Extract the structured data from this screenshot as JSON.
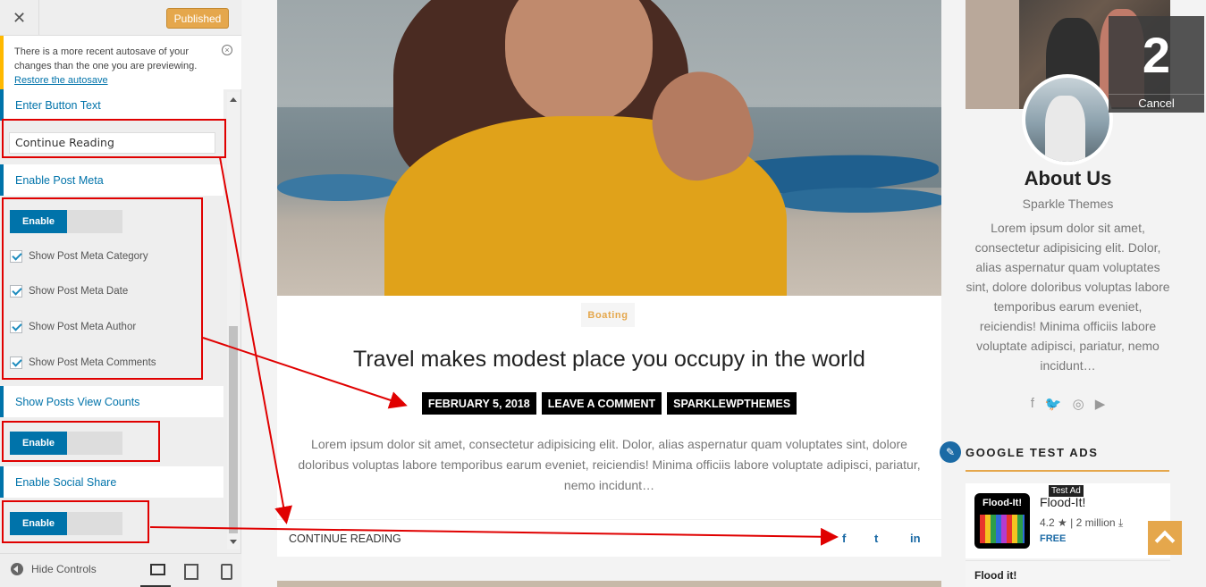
{
  "sidebar": {
    "published_label": "Published",
    "notice": {
      "text": "There is a more recent autosave of your changes than the one you are previewing.",
      "link": "Restore the autosave"
    },
    "sections": {
      "button_text": {
        "title": "Enter Button Text",
        "value": "Continue Reading"
      },
      "post_meta": {
        "title": "Enable Post Meta",
        "toggle_label": "Enable",
        "checkboxes": [
          "Show Post Meta Category",
          "Show Post Meta Date",
          "Show Post Meta Author",
          "Show Post Meta Comments"
        ]
      },
      "view_counts": {
        "title": "Show Posts View Counts",
        "toggle_label": "Enable"
      },
      "social_share": {
        "title": "Enable Social Share",
        "toggle_label": "Enable"
      }
    },
    "footer": {
      "hide_controls": "Hide Controls"
    }
  },
  "post": {
    "category": "Boating",
    "title": "Travel makes modest place you occupy in the world",
    "meta": [
      "FEBRUARY 5, 2018",
      "LEAVE A COMMENT",
      "SPARKLEWPTHEMES"
    ],
    "excerpt": "Lorem ipsum dolor sit amet, consectetur adipisicing elit. Dolor, alias aspernatur quam voluptates sint, dolore doloribus voluptas labore temporibus earum eveniet, reiciendis! Minima officiis labore voluptate adipisci, pariatur, nemo incidunt…",
    "continue": "CONTINUE READING",
    "social": [
      "f",
      "t",
      "in"
    ]
  },
  "about": {
    "title": "About Us",
    "subtitle": "Sparkle Themes",
    "text": "Lorem ipsum dolor sit amet, consectetur adipisicing elit. Dolor, alias aspernatur quam voluptates sint, dolore doloribus voluptas labore temporibus earum eveniet, reiciendis! Minima officiis labore voluptate adipisci, pariatur, nemo incidunt…",
    "social_icons": [
      "facebook-icon",
      "twitter-icon",
      "instagram-icon",
      "youtube-icon"
    ]
  },
  "overlay": {
    "number": "2",
    "cancel": "Cancel"
  },
  "ads": {
    "title": "GOOGLE TEST ADS",
    "tag": "Test Ad",
    "app_name": "Flood-It!",
    "icon_text": "Flood-It!",
    "rating": "4.2",
    "installs": "2 million",
    "price": "FREE",
    "app2_name": "Flood it!"
  },
  "colors": {
    "accent": "#e5a74c",
    "wp_blue": "#0073aa",
    "annotation": "#e00000"
  }
}
